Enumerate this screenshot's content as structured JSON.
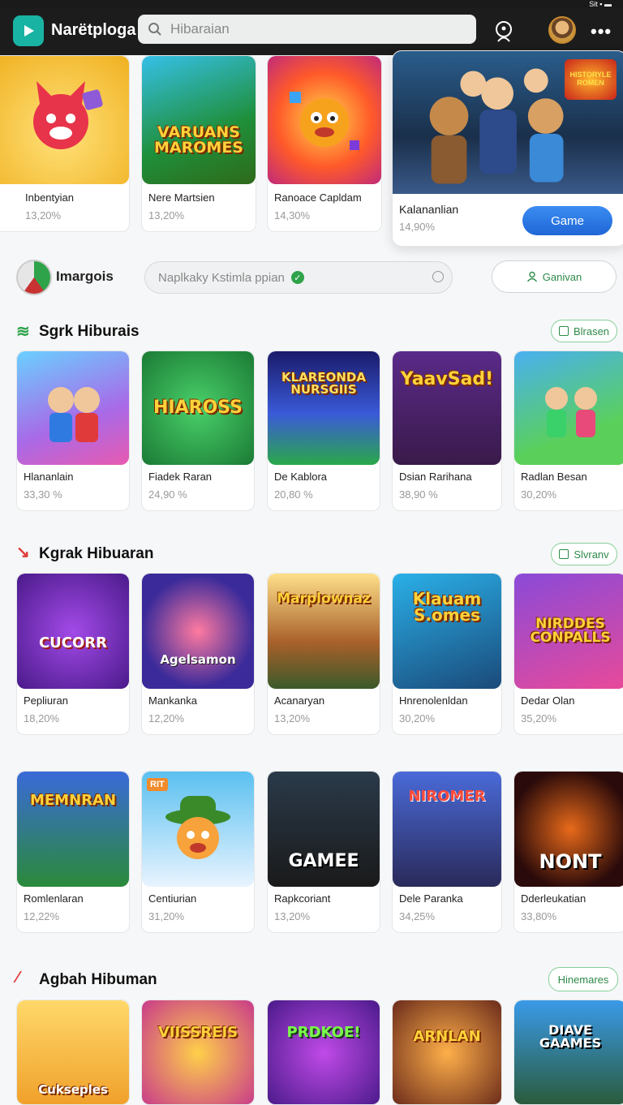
{
  "status": {
    "text": "Sit ▪ ▬"
  },
  "header": {
    "app_title": "Narëtploga",
    "search_placeholder": "Hibaraian"
  },
  "featured": {
    "items": [
      {
        "name": "Inbentyian",
        "pct": "13,20%",
        "thumb_text": ""
      },
      {
        "name": "Nere Martsien",
        "pct": "13,20%",
        "thumb_text": "VARUANS MAROMES"
      },
      {
        "name": "Ranoace Capldam",
        "pct": "14,30%",
        "thumb_text": ""
      }
    ],
    "hero": {
      "name": "Kalananlian",
      "pct": "14,90%",
      "badge": "HISTORYLE ROMEN",
      "button": "Game"
    }
  },
  "filter": {
    "label": "Imargois",
    "input_text": "Naplkaky Kstimla ppian",
    "button": "Ganivan"
  },
  "sections": [
    {
      "title": "Sgrk Hiburais",
      "pill": "Blrasen",
      "items": [
        {
          "name": "Hlananlain",
          "pct": "33,30 %",
          "thumb_text": ""
        },
        {
          "name": "Fiadek Raran",
          "pct": "24,90 %",
          "thumb_text": "HIAROSS"
        },
        {
          "name": "De Kablora",
          "pct": "20,80 %",
          "thumb_text": "KLAREONDA NURSGIIS"
        },
        {
          "name": "Dsian Rarihana",
          "pct": "38,90 %",
          "thumb_text": "YaavSad!"
        },
        {
          "name": "Radlan Besan",
          "pct": "30,20%",
          "thumb_text": ""
        }
      ]
    },
    {
      "title": "Kgrak Hibuaran",
      "pill": "Slvranv",
      "items": [
        {
          "name": "Pepliuran",
          "pct": "18,20%",
          "thumb_text": "CUCORR"
        },
        {
          "name": "Mankanka",
          "pct": "12,20%",
          "thumb_text": "Agelsamon"
        },
        {
          "name": "Acanaryan",
          "pct": "13,20%",
          "thumb_text": "Marplownaz"
        },
        {
          "name": "Hnrenolenldan",
          "pct": "30,20%",
          "thumb_text": "Klauam S.omes"
        },
        {
          "name": "Dedar Olan",
          "pct": "35,20%",
          "thumb_text": "NIRDDES CONPALLS"
        }
      ]
    },
    {
      "title": "",
      "pill": "",
      "items": [
        {
          "name": "Romlenlaran",
          "pct": "12,22%",
          "thumb_text": "MEMNRAN"
        },
        {
          "name": "Centiurian",
          "pct": "31,20%",
          "thumb_text": "RIT"
        },
        {
          "name": "Rapkcoriant",
          "pct": "13,20%",
          "thumb_text": "GAMEE"
        },
        {
          "name": "Dele Paranka",
          "pct": "34,25%",
          "thumb_text": "NIROMER"
        },
        {
          "name": "Dderleukatian",
          "pct": "33,80%",
          "thumb_text": "NONT"
        }
      ]
    },
    {
      "title": "Agbah Hibuman",
      "pill": "Hinemares",
      "items": [
        {
          "name": "",
          "pct": "",
          "thumb_text": "Cukseples"
        },
        {
          "name": "",
          "pct": "",
          "thumb_text": "VIISSREIS"
        },
        {
          "name": "",
          "pct": "",
          "thumb_text": "PRDKOE!"
        },
        {
          "name": "",
          "pct": "",
          "thumb_text": "ARNLAN"
        },
        {
          "name": "",
          "pct": "",
          "thumb_text": "DIAVE GAAMES"
        }
      ]
    }
  ],
  "colors": {
    "accent_green": "#2f8a4a",
    "brand_teal": "#19b3a3",
    "button_blue": "#2a74e0"
  }
}
